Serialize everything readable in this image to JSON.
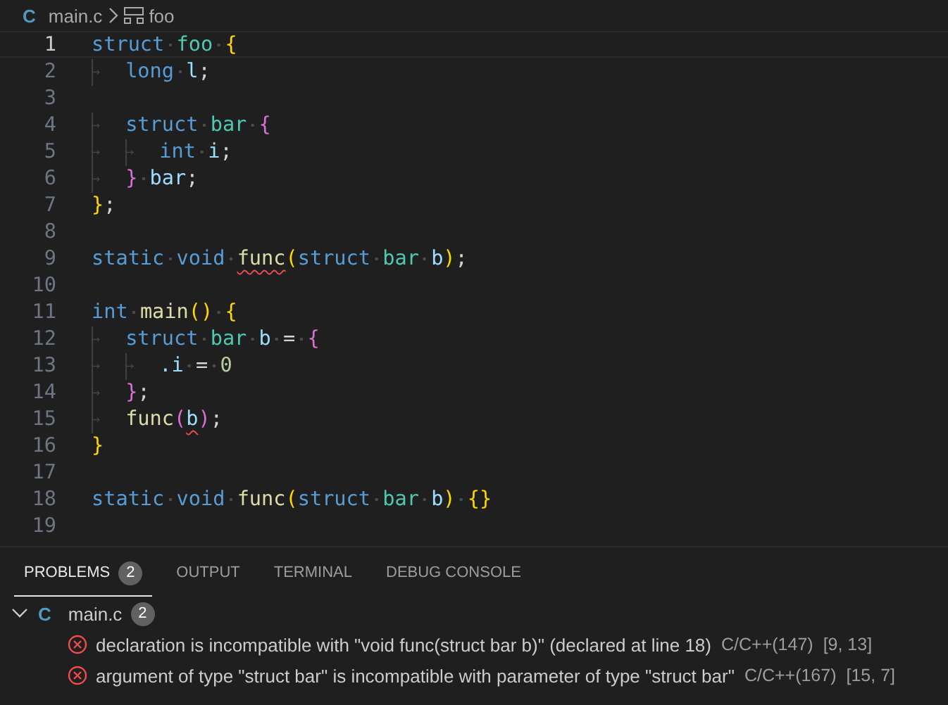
{
  "breadcrumb": {
    "file_icon": "C",
    "file": "main.c",
    "symbol": "foo"
  },
  "editor": {
    "lines": [
      {
        "number": "1",
        "current": true,
        "tokens": [
          {
            "text": "struct ",
            "kind": "keyword"
          },
          {
            "text": "foo ",
            "kind": "type"
          },
          {
            "text": "{",
            "kind": "bracket1"
          }
        ]
      },
      {
        "number": "2",
        "current": false,
        "tokens": [
          {
            "text": "→",
            "kind": "tab"
          },
          {
            "text": "long ",
            "kind": "keyword"
          },
          {
            "text": "l",
            "kind": "var"
          },
          {
            "text": ";",
            "kind": "punct"
          }
        ]
      },
      {
        "number": "3",
        "current": false
      },
      {
        "number": "4",
        "current": false,
        "tokens": [
          {
            "text": "→",
            "kind": "tab"
          },
          {
            "text": "struct ",
            "kind": "keyword"
          },
          {
            "text": "bar ",
            "kind": "type"
          },
          {
            "text": "{",
            "kind": "bracket2"
          }
        ]
      },
      {
        "number": "5",
        "current": false,
        "tokens": [
          {
            "text": "→",
            "kind": "tab"
          },
          {
            "text": "→",
            "kind": "tab"
          },
          {
            "text": "int ",
            "kind": "keyword"
          },
          {
            "text": "i",
            "kind": "var"
          },
          {
            "text": ";",
            "kind": "punct"
          }
        ]
      },
      {
        "number": "6",
        "current": false,
        "tokens": [
          {
            "text": "→",
            "kind": "tab"
          },
          {
            "text": "} ",
            "kind": "bracket2"
          },
          {
            "text": "bar",
            "kind": "var"
          },
          {
            "text": ";",
            "kind": "punct"
          }
        ]
      },
      {
        "number": "7",
        "current": false,
        "tokens": [
          {
            "text": "}",
            "kind": "bracket1"
          },
          {
            "text": ";",
            "kind": "punct"
          }
        ]
      },
      {
        "number": "8",
        "current": false
      },
      {
        "number": "9",
        "current": false,
        "tokens": [
          {
            "text": "static void ",
            "kind": "keyword"
          },
          {
            "text": "func",
            "kind": "func",
            "error": true
          },
          {
            "text": "(",
            "kind": "bracket1"
          },
          {
            "text": "struct ",
            "kind": "keyword"
          },
          {
            "text": "bar ",
            "kind": "type"
          },
          {
            "text": "b",
            "kind": "var"
          },
          {
            "text": ")",
            "kind": "bracket1"
          },
          {
            "text": ";",
            "kind": "punct"
          }
        ]
      },
      {
        "number": "10",
        "current": false
      },
      {
        "number": "11",
        "current": false,
        "tokens": [
          {
            "text": "int ",
            "kind": "keyword"
          },
          {
            "text": "main",
            "kind": "func"
          },
          {
            "text": "() {",
            "kind": "bracket1"
          }
        ]
      },
      {
        "number": "12",
        "current": false,
        "tokens": [
          {
            "text": "→",
            "kind": "tab"
          },
          {
            "text": "struct ",
            "kind": "keyword"
          },
          {
            "text": "bar ",
            "kind": "type"
          },
          {
            "text": "b",
            "kind": "var"
          },
          {
            "text": " = ",
            "kind": "punct"
          },
          {
            "text": "{",
            "kind": "bracket2"
          }
        ]
      },
      {
        "number": "13",
        "current": false,
        "tokens": [
          {
            "text": "→",
            "kind": "tab"
          },
          {
            "text": "→",
            "kind": "tab"
          },
          {
            "text": ".i",
            "kind": "var"
          },
          {
            "text": " = ",
            "kind": "punct"
          },
          {
            "text": "0",
            "kind": "number"
          }
        ]
      },
      {
        "number": "14",
        "current": false,
        "tokens": [
          {
            "text": "→",
            "kind": "tab"
          },
          {
            "text": "}",
            "kind": "bracket2"
          },
          {
            "text": ";",
            "kind": "punct"
          }
        ]
      },
      {
        "number": "15",
        "current": false,
        "tokens": [
          {
            "text": "→",
            "kind": "tab"
          },
          {
            "text": "func",
            "kind": "func"
          },
          {
            "text": "(",
            "kind": "bracket2"
          },
          {
            "text": "b",
            "kind": "var",
            "error": true
          },
          {
            "text": ")",
            "kind": "bracket2"
          },
          {
            "text": ";",
            "kind": "punct"
          }
        ]
      },
      {
        "number": "16",
        "current": false,
        "tokens": [
          {
            "text": "}",
            "kind": "bracket1"
          }
        ]
      },
      {
        "number": "17",
        "current": false
      },
      {
        "number": "18",
        "current": false,
        "tokens": [
          {
            "text": "static void ",
            "kind": "keyword"
          },
          {
            "text": "func",
            "kind": "func"
          },
          {
            "text": "(",
            "kind": "bracket1"
          },
          {
            "text": "struct ",
            "kind": "keyword"
          },
          {
            "text": "bar ",
            "kind": "type"
          },
          {
            "text": "b",
            "kind": "var"
          },
          {
            "text": ")",
            "kind": "bracket1"
          },
          {
            "text": " {}",
            "kind": "bracket1"
          }
        ]
      },
      {
        "number": "19",
        "current": false
      }
    ]
  },
  "panel": {
    "tabs": [
      {
        "label": "PROBLEMS",
        "selected": true,
        "badge": "2"
      },
      {
        "label": "OUTPUT",
        "selected": false
      },
      {
        "label": "TERMINAL",
        "selected": false
      },
      {
        "label": "DEBUG CONSOLE",
        "selected": false
      }
    ],
    "files": [
      {
        "file_icon": "C",
        "name": "main.c",
        "count": "2",
        "expanded": true,
        "problems": [
          {
            "kind": "error",
            "message": "declaration is incompatible with \"void func(struct bar b)\" (declared at line 18)",
            "source": "C/C++(147)",
            "location": "[9, 13]"
          },
          {
            "kind": "error",
            "message": "argument of type \"struct bar\" is incompatible with parameter of type \"struct bar\"",
            "source": "C/C++(167)",
            "location": "[15, 7]"
          }
        ]
      }
    ]
  }
}
